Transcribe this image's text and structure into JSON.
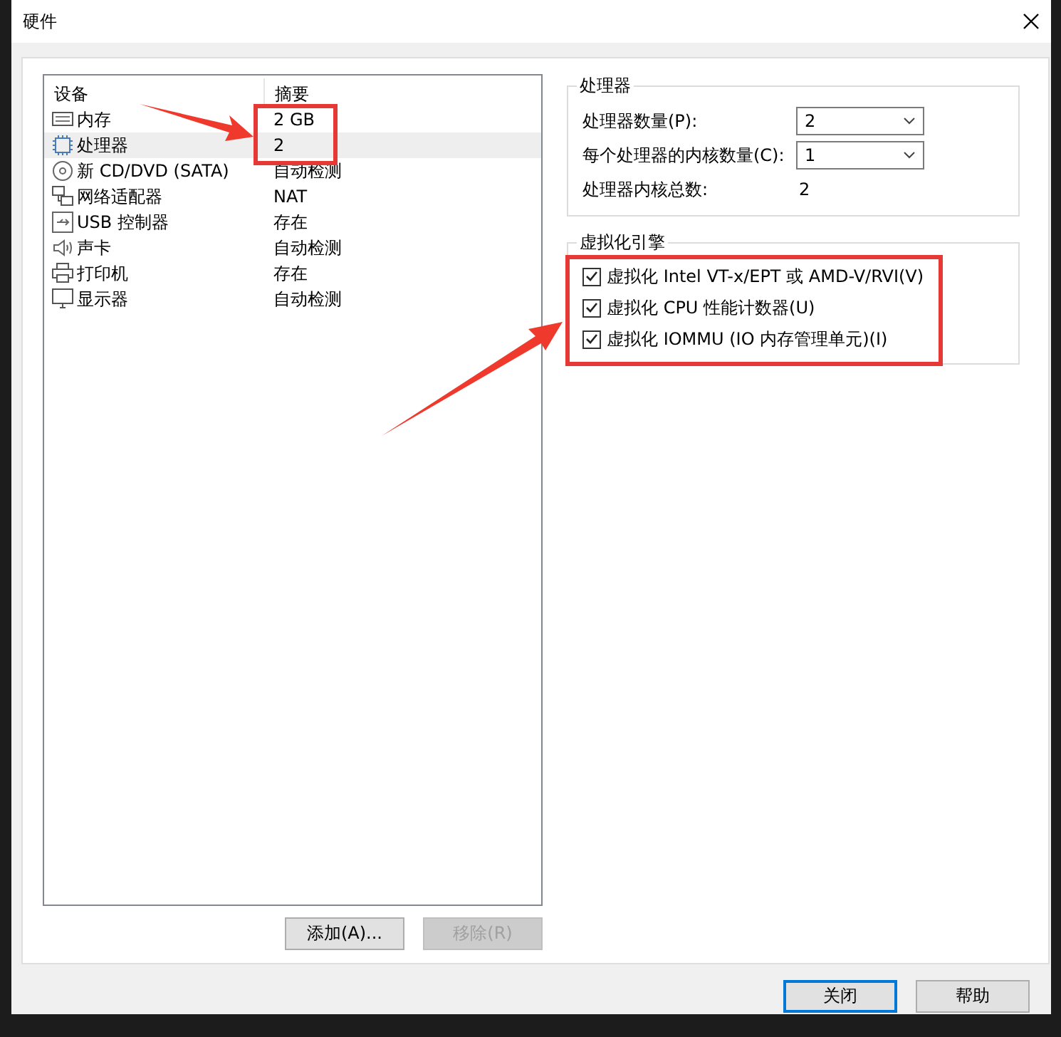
{
  "window": {
    "title": "硬件"
  },
  "device_list": {
    "columns": [
      "设备",
      "摘要"
    ],
    "rows": [
      {
        "kind": "memory",
        "name": "内存",
        "summary": "2 GB",
        "selected": false
      },
      {
        "kind": "cpu",
        "name": "处理器",
        "summary": "2",
        "selected": true
      },
      {
        "kind": "cd",
        "name": "新 CD/DVD (SATA)",
        "summary": "自动检测",
        "selected": false
      },
      {
        "kind": "network",
        "name": "网络适配器",
        "summary": "NAT",
        "selected": false
      },
      {
        "kind": "usb",
        "name": "USB 控制器",
        "summary": "存在",
        "selected": false
      },
      {
        "kind": "sound",
        "name": "声卡",
        "summary": "自动检测",
        "selected": false
      },
      {
        "kind": "printer",
        "name": "打印机",
        "summary": "存在",
        "selected": false
      },
      {
        "kind": "display",
        "name": "显示器",
        "summary": "自动检测",
        "selected": false
      }
    ]
  },
  "list_buttons": [
    {
      "label": "添加(A)...",
      "disabled": false
    },
    {
      "label": "移除(R)",
      "disabled": true
    }
  ],
  "processor_group": {
    "title": "处理器",
    "fields": [
      {
        "kind": "dropdown",
        "label": "处理器数量(P):",
        "value": "2"
      },
      {
        "kind": "dropdown",
        "label": "每个处理器的内核数量(C):",
        "value": "1"
      },
      {
        "kind": "text",
        "label": "处理器内核总数:",
        "value": "2"
      }
    ]
  },
  "virtualization_group": {
    "title": "虚拟化引擎",
    "options": [
      {
        "label": "虚拟化 Intel VT-x/EPT 或 AMD-V/RVI(V)",
        "checked": true
      },
      {
        "label": "虚拟化 CPU 性能计数器(U)",
        "checked": true
      },
      {
        "label": "虚拟化 IOMMU (IO 内存管理单元)(I)",
        "checked": true
      }
    ]
  },
  "dialog_buttons": [
    {
      "label": "关闭",
      "default": true
    },
    {
      "label": "帮助",
      "default": false
    }
  ]
}
